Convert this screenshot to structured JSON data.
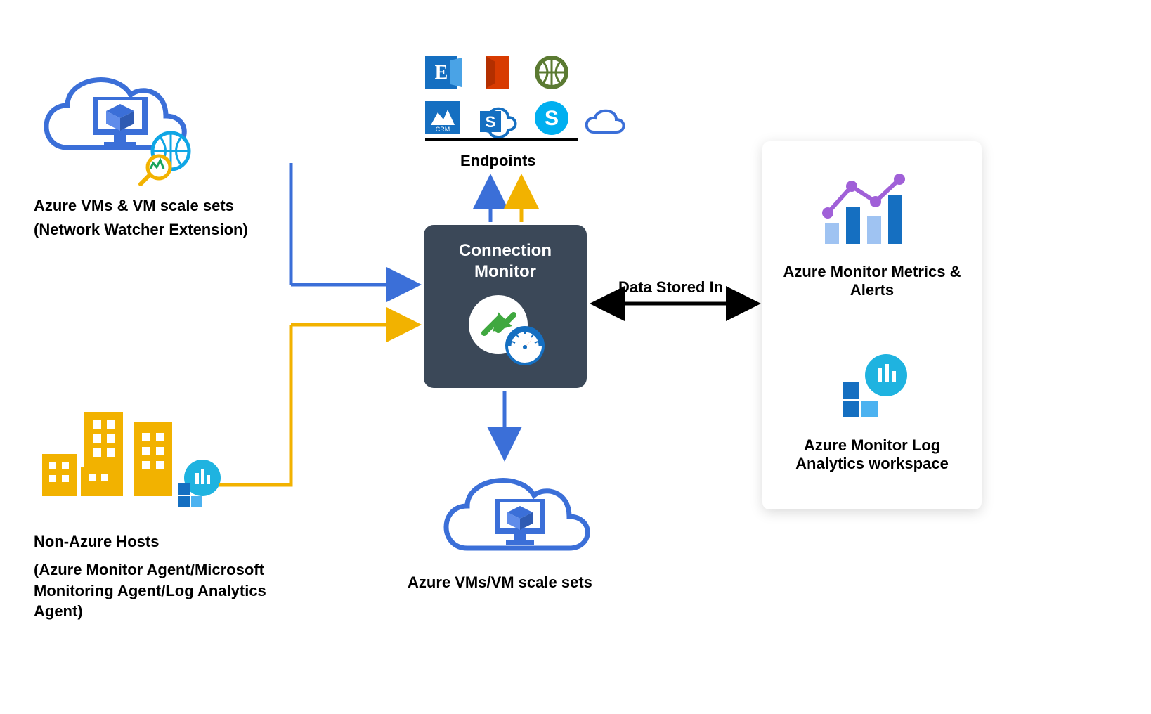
{
  "azure_vms_source": {
    "title": "Azure VMs & VM scale sets",
    "subtitle": "(Network Watcher Extension)"
  },
  "non_azure_hosts": {
    "title": "Non-Azure Hosts",
    "subtitle": "(Azure Monitor Agent/Microsoft Monitoring Agent/Log Analytics Agent)"
  },
  "endpoints": {
    "label": "Endpoints"
  },
  "center": {
    "title_line1": "Connection",
    "title_line2": "Monitor"
  },
  "azure_vms_dest": {
    "label": "Azure VMs/VM scale sets"
  },
  "data_stored": {
    "label": "Data Stored In"
  },
  "right": {
    "metrics_title": "Azure Monitor Metrics & Alerts",
    "log_title": "Azure Monitor Log Analytics workspace"
  }
}
